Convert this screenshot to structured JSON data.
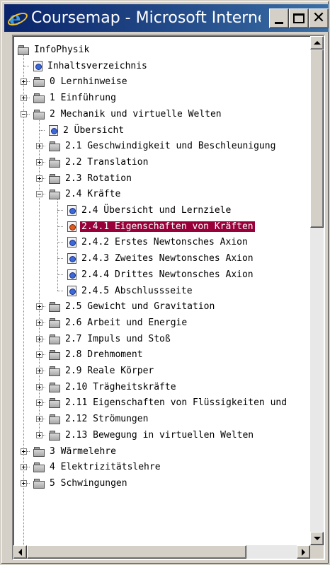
{
  "window": {
    "title": "Coursemap - Microsoft Internet...",
    "title_bar_color": "#0a246a",
    "buttons": [
      "minimize",
      "maximize",
      "close"
    ]
  },
  "tree": {
    "selection_color": "#98003a",
    "items": [
      {
        "label": "InfoPhysik",
        "icon": "folder-open-icon",
        "depth": 0,
        "expander": "none"
      },
      {
        "label": "Inhaltsverzeichnis",
        "icon": "page-icon",
        "depth": 1,
        "expander": "none"
      },
      {
        "label": "0 Lernhinweise",
        "icon": "folder-icon",
        "depth": 1,
        "expander": "plus"
      },
      {
        "label": "1 Einführung",
        "icon": "folder-icon",
        "depth": 1,
        "expander": "plus"
      },
      {
        "label": "2 Mechanik und virtuelle Welten",
        "icon": "folder-icon",
        "depth": 1,
        "expander": "minus"
      },
      {
        "label": "2 Übersicht",
        "icon": "page-icon",
        "depth": 2,
        "expander": "none"
      },
      {
        "label": "2.1 Geschwindigkeit und Beschleunigung",
        "icon": "folder-icon",
        "depth": 2,
        "expander": "plus"
      },
      {
        "label": "2.2 Translation",
        "icon": "folder-icon",
        "depth": 2,
        "expander": "plus"
      },
      {
        "label": "2.3 Rotation",
        "icon": "folder-icon",
        "depth": 2,
        "expander": "plus"
      },
      {
        "label": "2.4 Kräfte",
        "icon": "folder-icon",
        "depth": 2,
        "expander": "minus"
      },
      {
        "label": "2.4 Übersicht und Lernziele",
        "icon": "page-icon",
        "depth": 3,
        "expander": "none"
      },
      {
        "label": "2.4.1 Eigenschaften von Kräften",
        "icon": "page-icon",
        "depth": 3,
        "expander": "none",
        "selected": true
      },
      {
        "label": "2.4.2 Erstes Newtonsches Axion",
        "icon": "page-icon",
        "depth": 3,
        "expander": "none"
      },
      {
        "label": "2.4.3 Zweites Newtonsches Axion",
        "icon": "page-icon",
        "depth": 3,
        "expander": "none"
      },
      {
        "label": "2.4.4 Drittes Newtonsches Axion",
        "icon": "page-icon",
        "depth": 3,
        "expander": "none"
      },
      {
        "label": "2.4.5 Abschlussseite",
        "icon": "page-icon",
        "depth": 3,
        "expander": "none"
      },
      {
        "label": "2.5 Gewicht und Gravitation",
        "icon": "folder-icon",
        "depth": 2,
        "expander": "plus"
      },
      {
        "label": "2.6 Arbeit und Energie",
        "icon": "folder-icon",
        "depth": 2,
        "expander": "plus"
      },
      {
        "label": "2.7 Impuls und Stoß",
        "icon": "folder-icon",
        "depth": 2,
        "expander": "plus"
      },
      {
        "label": "2.8 Drehmoment",
        "icon": "folder-icon",
        "depth": 2,
        "expander": "plus"
      },
      {
        "label": "2.9 Reale Körper",
        "icon": "folder-icon",
        "depth": 2,
        "expander": "plus"
      },
      {
        "label": "2.10 Trägheitskräfte",
        "icon": "folder-icon",
        "depth": 2,
        "expander": "plus"
      },
      {
        "label": "2.11 Eigenschaften von Flüssigkeiten und",
        "icon": "folder-icon",
        "depth": 2,
        "expander": "plus"
      },
      {
        "label": "2.12 Strömungen",
        "icon": "folder-icon",
        "depth": 2,
        "expander": "plus"
      },
      {
        "label": "2.13 Bewegung in virtuellen Welten",
        "icon": "folder-icon",
        "depth": 2,
        "expander": "plus"
      },
      {
        "label": "3 Wärmelehre",
        "icon": "folder-icon",
        "depth": 1,
        "expander": "plus"
      },
      {
        "label": "4 Elektrizitätslehre",
        "icon": "folder-icon",
        "depth": 1,
        "expander": "plus"
      },
      {
        "label": "5 Schwingungen",
        "icon": "folder-icon",
        "depth": 1,
        "expander": "plus"
      }
    ]
  }
}
